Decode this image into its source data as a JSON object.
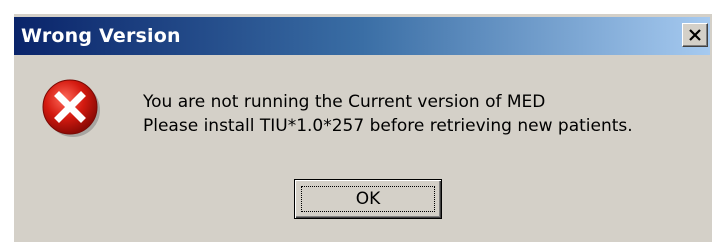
{
  "window": {
    "title": "Wrong Version",
    "close_label": "×"
  },
  "icon": {
    "name": "error-icon",
    "color": "#c81010"
  },
  "message": {
    "line1": "You are not running the Current version of MED",
    "line2": "Please install TIU*1.0*257 before retrieving new patients."
  },
  "buttons": {
    "ok_label": "OK"
  },
  "colors": {
    "face": "#d4d0c8",
    "title_start": "#0a246a",
    "title_end": "#a6caf0",
    "error_red": "#c81010"
  }
}
